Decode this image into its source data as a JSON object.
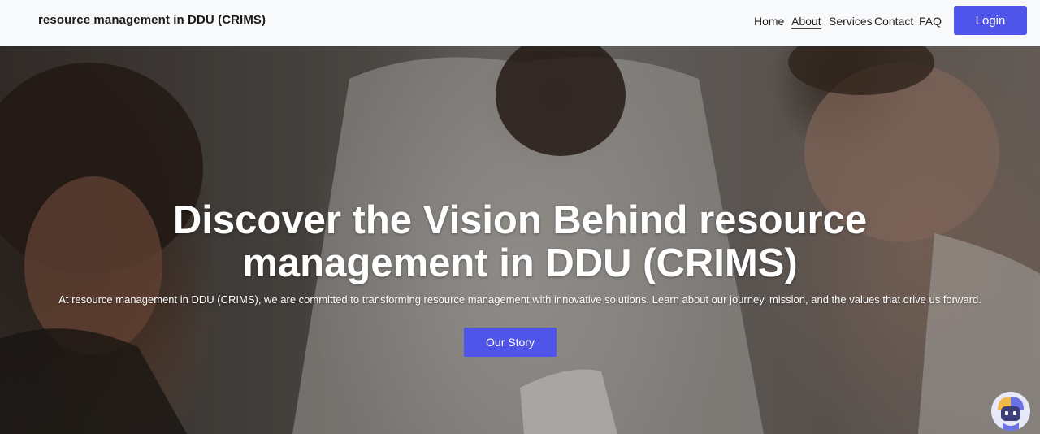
{
  "navbar": {
    "brand": "resource management in DDU (CRIMS)",
    "links": [
      "Home",
      "About",
      "Services",
      "Contact",
      "FAQ"
    ],
    "active_link": "About",
    "login_label": "Login"
  },
  "hero": {
    "title": "Discover the Vision Behind resource management in DDU (CRIMS)",
    "description": "At resource management in DDU (CRIMS), we are committed to transforming resource management with innovative solutions. Learn about our journey, mission, and the values that drive us forward.",
    "button_label": "Our Story"
  },
  "colors": {
    "accent": "#4f55e8",
    "navbar_bg": "#f8f9fb"
  },
  "icons": {
    "chat": "chatbot-robot-icon"
  }
}
